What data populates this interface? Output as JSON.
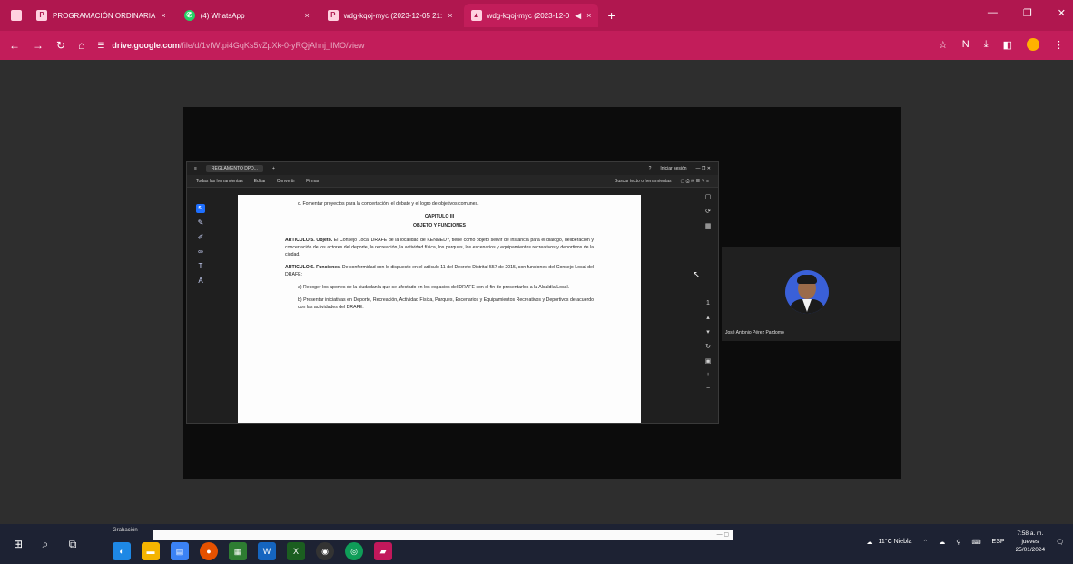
{
  "browser": {
    "tabs": [
      {
        "label": "PROGRAMACIÓN ORDINARIA",
        "icon": "pp-icon"
      },
      {
        "label": "(4) WhatsApp",
        "icon": "whatsapp-icon"
      },
      {
        "label": "wdg-kqoj-myc (2023-12-05 21:",
        "icon": "pp-icon"
      },
      {
        "label": "wdg-kqoj-myc (2023-12-0",
        "icon": "drive-icon"
      }
    ],
    "url_host": "drive.google.com",
    "url_path": "/file/d/1vfWtpi4GqKs5vZpXk-0-yRQjAhnj_IMO/view"
  },
  "pdf": {
    "tab_label": "REGLAMENTO DPD...",
    "menu": [
      "Todas las herramientas",
      "Editar",
      "Convertir",
      "Firmar"
    ],
    "search_hint": "Buscar texto o herramientas",
    "signin": "Iniciar sesión",
    "paragraphs": [
      {
        "text": "c.   Fomentar proyectos para la concertación, el debate y el logro de objetivos comunes.",
        "indent": true
      },
      {
        "title": "CAPITULO III"
      },
      {
        "title": "OBJETO Y FUNCIONES"
      },
      {
        "bold": "ARTICULO 5. Objeto.",
        "text": " El Consejo Local DRAFE de la localidad de KENNEDY, tiene como objeto servir de instancia para el diálogo, deliberación y concertación de los actores del deporte, la recreación, la actividad física, los parques, los escenarios y equipamientos recreativos y deportivos de la ciudad."
      },
      {
        "bold": "ARTICULO 6. Funciones.",
        "text": " De conformidad con lo dispuesto en el artículo 11 del Decreto Distrital 557 de 2015, son funciones del Consejo Local del DRAFE:"
      },
      {
        "text": "a)  Recoger los aportes de la ciudadanía que se afectado en los espacios del DRAFE con el fin de presentarlos a la Alcaldía Local.",
        "indent": true
      },
      {
        "text": "b)  Presentar iniciativas en Deporte, Recreación, Actividad Física, Parques, Escenarios y Equipamientos Recreativos y Deportivos de acuerdo con las actividades del DRAFE.",
        "indent": true
      }
    ]
  },
  "participant": {
    "name": "José Antonio Pérez Pardomo"
  },
  "taskbar": {
    "search_label": "Grabación",
    "weather": "11°C Niebla",
    "lang": "ESP",
    "time": "7:58 a. m.",
    "day": "jueves",
    "date": "25/01/2024"
  },
  "colors": {
    "browser_accent": "#b0174f",
    "taskbar": "#1d2233"
  }
}
